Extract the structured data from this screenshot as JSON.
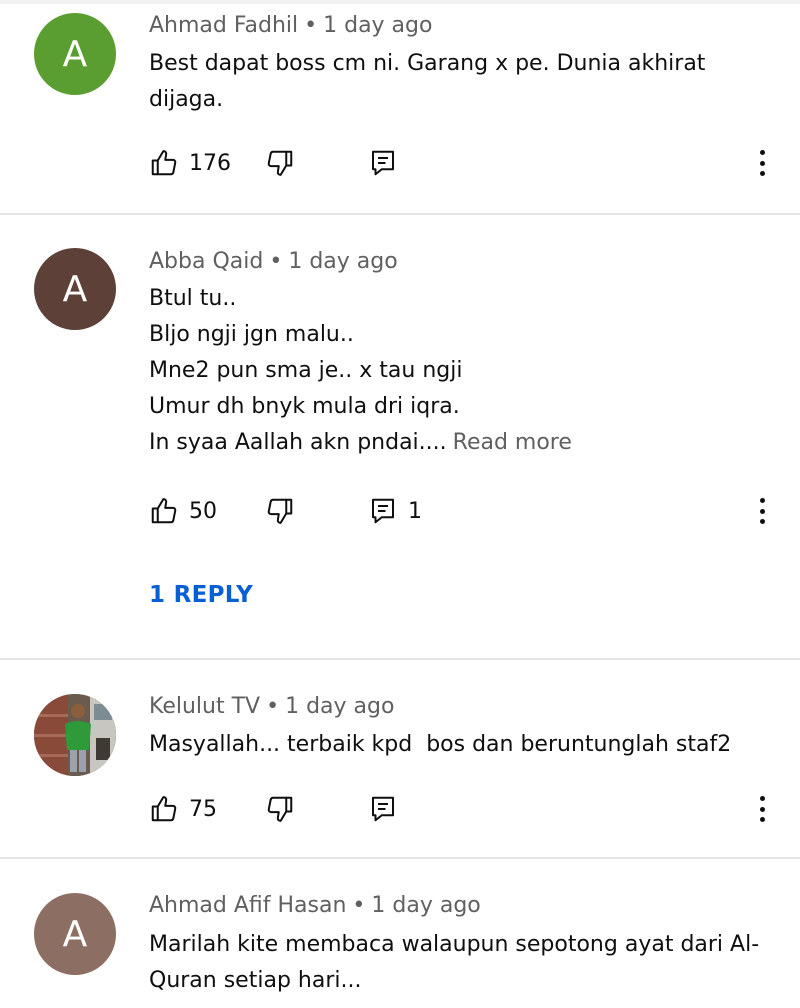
{
  "comments": [
    {
      "author": "Ahmad Fadhil",
      "time": "1 day ago",
      "avatar_letter": "A",
      "avatar_color": "#5a9e32",
      "lines": [
        "Best dapat boss cm ni. Garang x pe. Dunia akhirat",
        "dijaga."
      ],
      "likes": "176",
      "reply_count": ""
    },
    {
      "author": "Abba Qaid",
      "time": "1 day ago",
      "avatar_letter": "A",
      "avatar_color": "#5d4037",
      "lines": [
        "Btul tu..",
        "Bljo ngji jgn malu..",
        "Mne2 pun sma je.. x tau ngji",
        "Umur dh bnyk mula dri iqra.",
        "In syaa Aallah akn pndai...."
      ],
      "read_more": "Read more",
      "likes": "50",
      "reply_count": "1",
      "replies_label": "1 REPLY"
    },
    {
      "author": "Kelulut TV",
      "time": "1 day ago",
      "avatar_kind": "photo",
      "lines": [
        "Masyallah... terbaik kpd  bos dan beruntunglah staf2"
      ],
      "likes": "75",
      "reply_count": ""
    },
    {
      "author": "Ahmad Afif Hasan",
      "time": "1 day ago",
      "avatar_letter": "A",
      "avatar_color": "#8d6e63",
      "lines": [
        "Marilah kite membaca walaupun sepotong ayat dari Al-",
        "Quran setiap hari..."
      ]
    }
  ],
  "separator": "•",
  "colors": {
    "link": "#065fd4",
    "meta": "#606060",
    "divider": "#e5e5e5"
  },
  "icons": [
    "like-icon",
    "dislike-icon",
    "reply-icon",
    "more-options-icon"
  ]
}
